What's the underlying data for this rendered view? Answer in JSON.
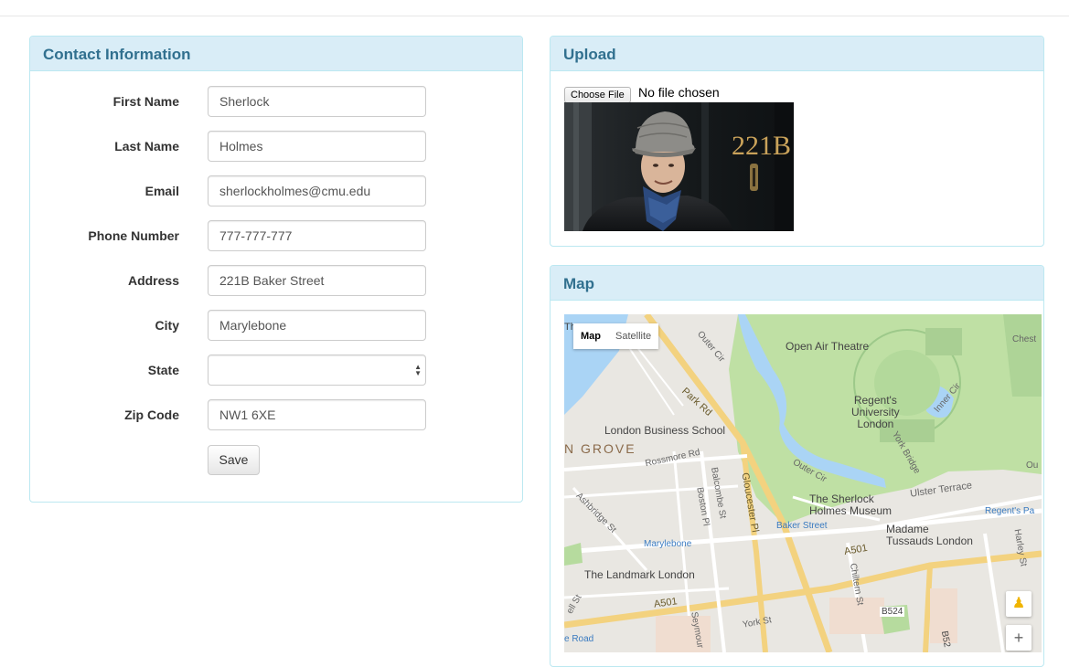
{
  "contact": {
    "title": "Contact Information",
    "fields": [
      {
        "label": "First Name",
        "value": "Sherlock"
      },
      {
        "label": "Last Name",
        "value": "Holmes"
      },
      {
        "label": "Email",
        "value": "sherlockholmes@cmu.edu"
      },
      {
        "label": "Phone Number",
        "value": "777-777-777"
      },
      {
        "label": "Address",
        "value": "221B Baker Street"
      },
      {
        "label": "City",
        "value": "Marylebone"
      },
      {
        "label": "State",
        "value": ""
      },
      {
        "label": "Zip Code",
        "value": "NW1 6XE"
      }
    ],
    "save_label": "Save"
  },
  "upload": {
    "title": "Upload",
    "choose_label": "Choose File",
    "file_status": "No file chosen",
    "photo": {
      "door_number": "221B"
    }
  },
  "map": {
    "title": "Map",
    "types": {
      "map": "Map",
      "satellite": "Satellite"
    },
    "zoom_in": "+",
    "labels": {
      "open_air_theatre": "Open Air Theatre",
      "regents_univ_1": "Regent's",
      "regents_univ_2": "University",
      "regents_univ_3": "London",
      "park_rd": "Park Rd",
      "outer_cir_1": "Outer Cir",
      "outer_cir_2": "Outer Cir",
      "inner_cir": "Inner Cir",
      "london_business_school": "London Business School",
      "grove": "N GROVE",
      "rossmore_rd": "Rossmore Rd",
      "balcombe_st": "Balcombe St",
      "boston_pl": "Boston Pl",
      "gloucester_pl": "Gloucester Pl",
      "york_bridge": "York Bridge",
      "sherlock_museum_1": "The Sherlock",
      "sherlock_museum_2": "Holmes Museum",
      "ulster_terrace": "Ulster Terrace",
      "baker_street": "Baker Street",
      "regents_park_station": "Regent's Pa",
      "madame_1": "Madame",
      "madame_2": "Tussauds London",
      "ashbridge_st": "Ashbridge St",
      "marylebone": "Marylebone",
      "a501_1": "A501",
      "a501_2": "A501",
      "landmark": "The Landmark London",
      "chiltern_st": "Chiltern St",
      "harley_st": "Harley St",
      "b524": "B524",
      "b52": "B52",
      "york_st": "York St",
      "seymour": "Seymour",
      "edgware_road": "e Road",
      "bell_st": "ell St",
      "chest": "Chest",
      "out": "Ou",
      "top_left": "The"
    }
  }
}
